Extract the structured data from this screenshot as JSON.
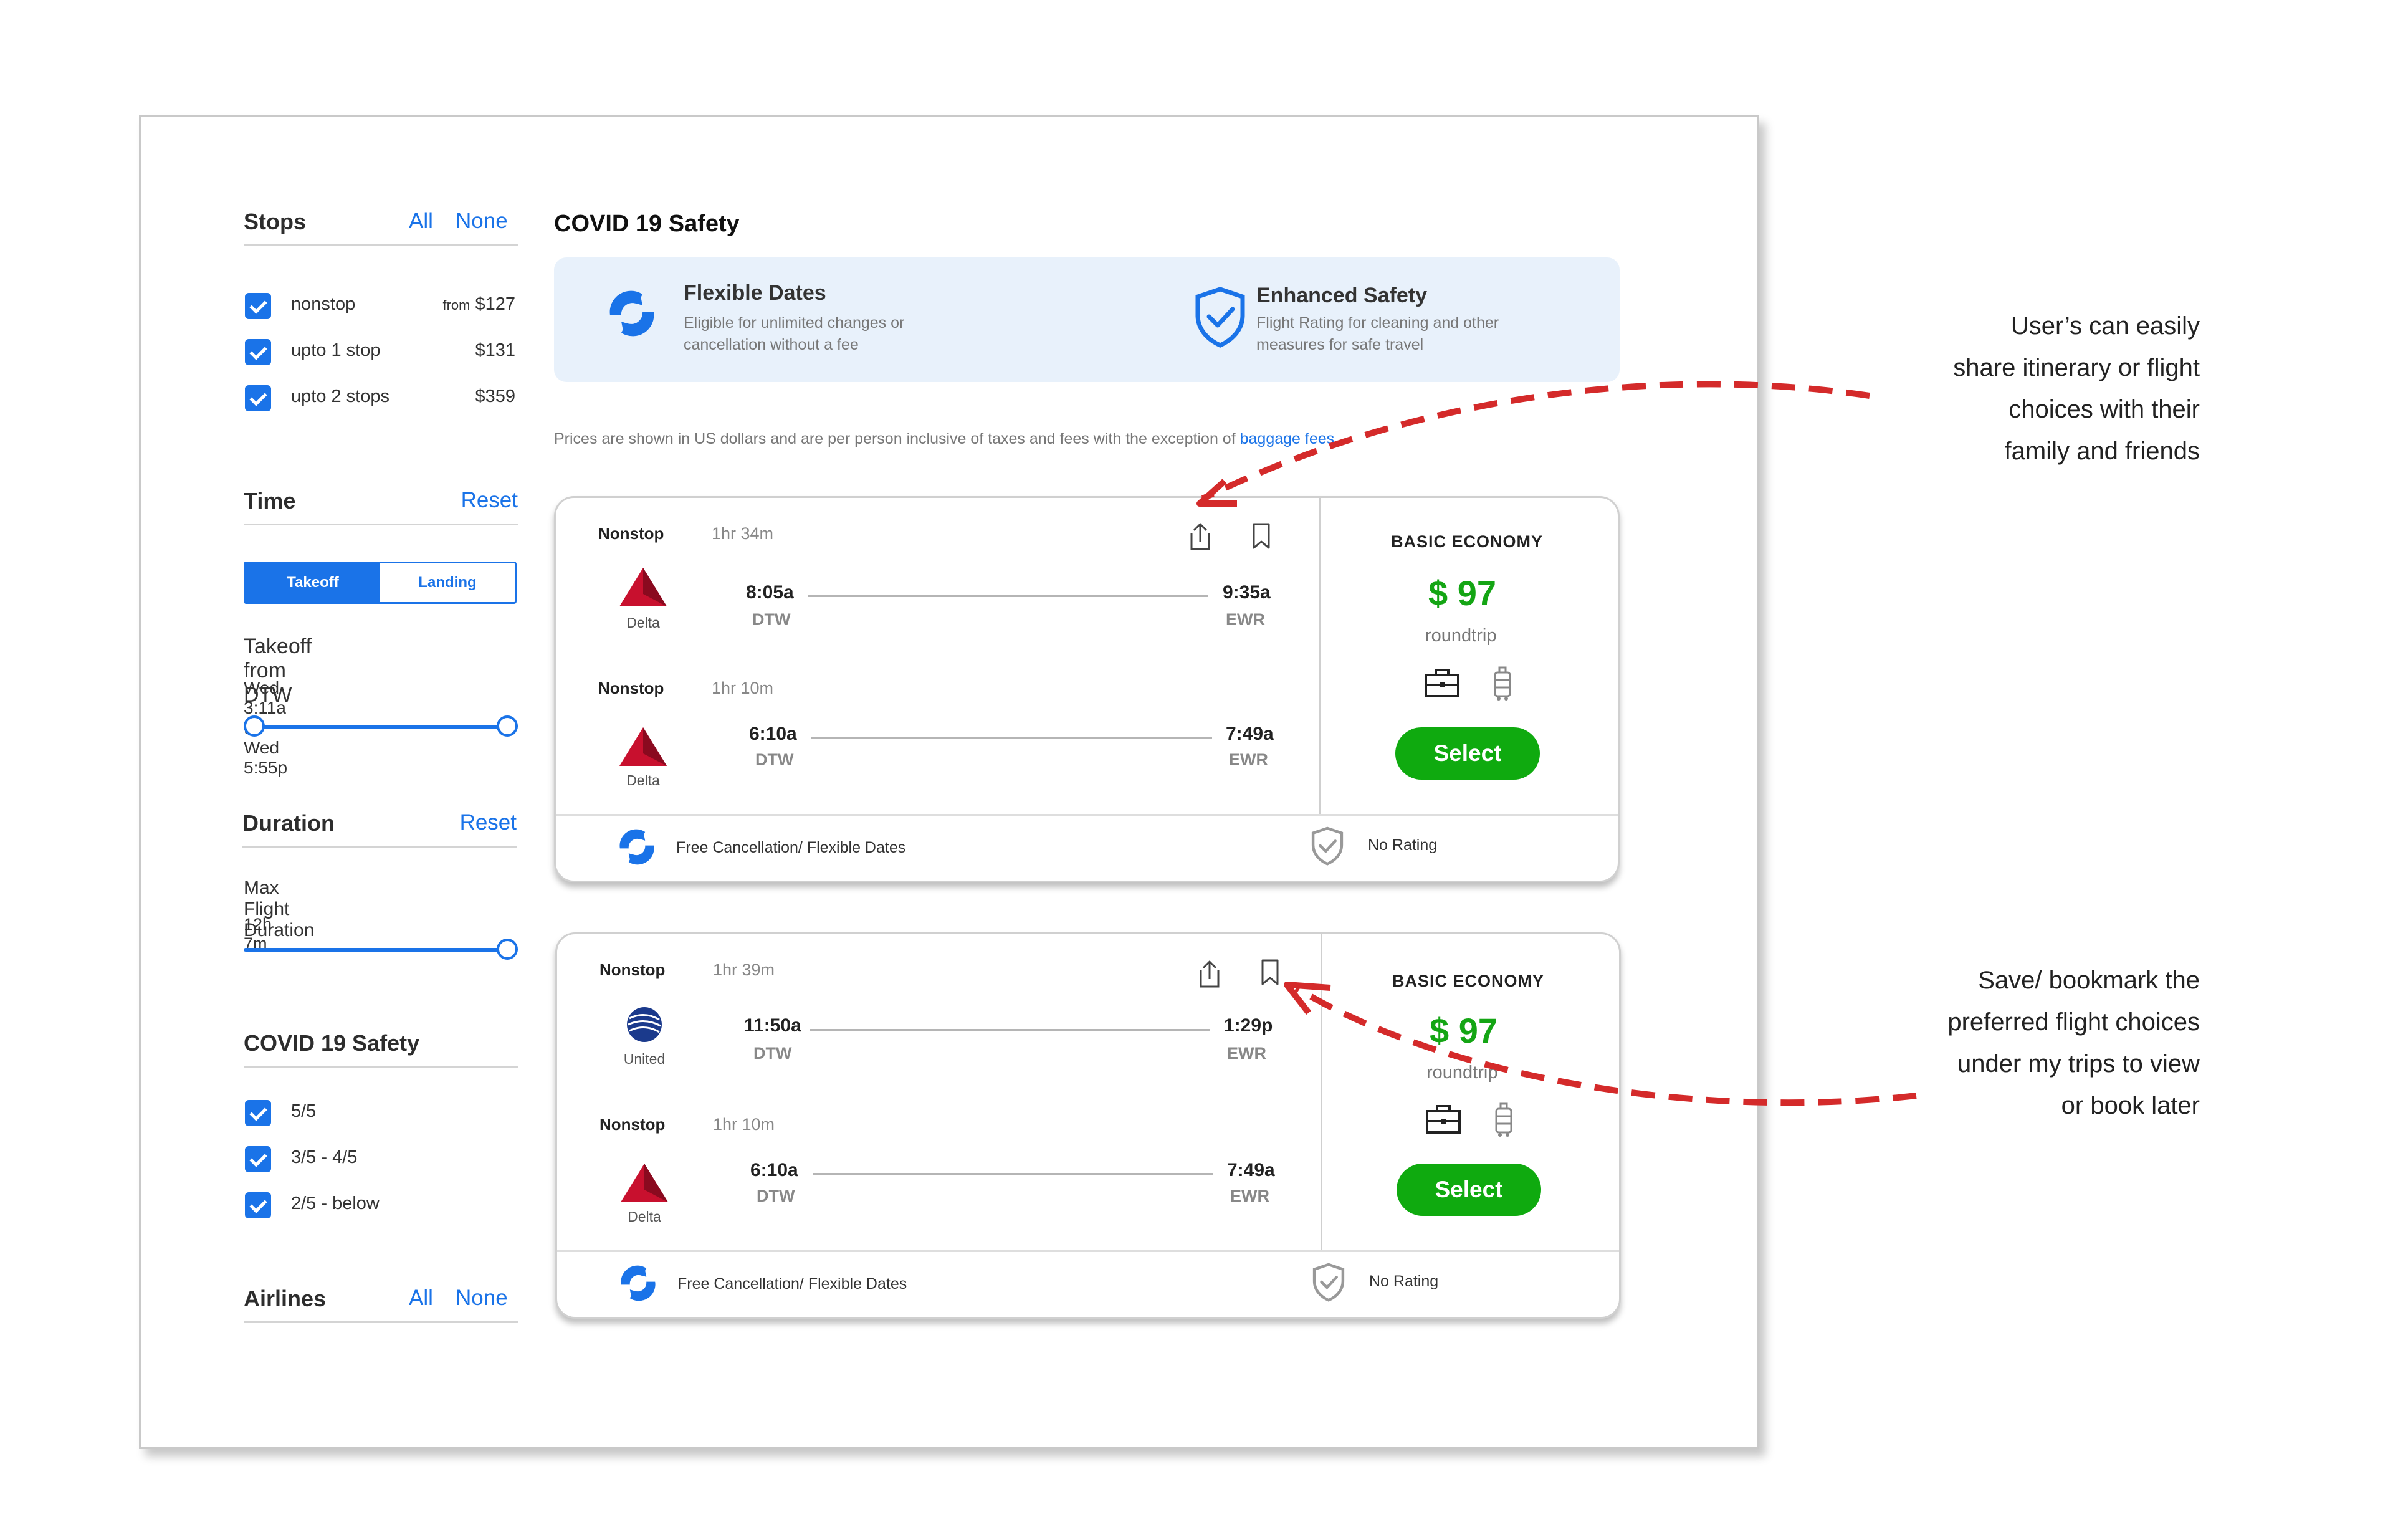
{
  "sidebar": {
    "stops": {
      "title": "Stops",
      "all": "All",
      "none": "None",
      "options": [
        {
          "label": "nonstop",
          "from": "from",
          "price": "$127"
        },
        {
          "label": "upto 1 stop",
          "price": "$131"
        },
        {
          "label": "upto 2 stops",
          "price": "$359"
        }
      ]
    },
    "time": {
      "title": "Time",
      "reset": "Reset",
      "tabs": [
        "Takeoff",
        "Landing"
      ],
      "takeoff_from": "Takeoff from DTW",
      "range": "Wed 3:11a to Wed 5:55p"
    },
    "duration": {
      "title": "Duration",
      "reset": "Reset",
      "label": "Max Flight Duration",
      "value": "12h 7m"
    },
    "covid": {
      "title": "COVID 19 Safety",
      "options": [
        "5/5",
        "3/5 - 4/5",
        "2/5 - below"
      ]
    },
    "airlines": {
      "title": "Airlines",
      "all": "All",
      "none": "None"
    }
  },
  "main": {
    "covid_title": "COVID 19  Safety",
    "features": [
      {
        "title": "Flexible Dates",
        "line1": "Eligible for unlimited changes or",
        "line2": "cancellation without a fee"
      },
      {
        "title": "Enhanced Safety",
        "line1": "Flight Rating for cleaning and other",
        "line2": "measures for safe travel"
      }
    ],
    "notice": "Prices are shown in US dollars and are per person inclusive of taxes and fees with the exception of ",
    "notice_link": "baggage fees"
  },
  "results": [
    {
      "legs": [
        {
          "stops": "Nonstop",
          "duration": "1hr 34m",
          "airline": "Delta",
          "depart_time": "8:05a",
          "depart_airport": "DTW",
          "arrive_time": "9:35a",
          "arrive_airport": "EWR"
        },
        {
          "stops": "Nonstop",
          "duration": "1hr 10m",
          "airline": "Delta",
          "depart_time": "6:10a",
          "depart_airport": "DTW",
          "arrive_time": "7:49a",
          "arrive_airport": "EWR"
        }
      ],
      "fare_class": "BASIC ECONOMY",
      "price": "$ 97",
      "price_note": "roundtrip",
      "select": "Select",
      "footer_flex": "Free Cancellation/ Flexible Dates",
      "footer_rating": "No Rating"
    },
    {
      "legs": [
        {
          "stops": "Nonstop",
          "duration": "1hr 39m",
          "airline": "United",
          "depart_time": "11:50a",
          "depart_airport": "DTW",
          "arrive_time": "1:29p",
          "arrive_airport": "EWR"
        },
        {
          "stops": "Nonstop",
          "duration": "1hr 10m",
          "airline": "Delta",
          "depart_time": "6:10a",
          "depart_airport": "DTW",
          "arrive_time": "7:49a",
          "arrive_airport": "EWR"
        }
      ],
      "fare_class": "BASIC ECONOMY",
      "price": "$ 97",
      "price_note": "roundtrip",
      "select": "Select",
      "footer_flex": "Free Cancellation/ Flexible Dates",
      "footer_rating": "No Rating"
    }
  ],
  "annotations": [
    {
      "lines": [
        "User’s can easily",
        "share itinerary or flight",
        "choices with their",
        "family and friends"
      ]
    },
    {
      "lines": [
        "Save/ bookmark the",
        "preferred flight choices",
        "under my trips to view",
        "or book later"
      ]
    }
  ],
  "colors": {
    "accent": "#1a73e8",
    "price": "#14a514",
    "select": "#0faa0f",
    "arrow": "#d42a2a",
    "delta": "#c8102e",
    "united": "#1b3a8c"
  }
}
